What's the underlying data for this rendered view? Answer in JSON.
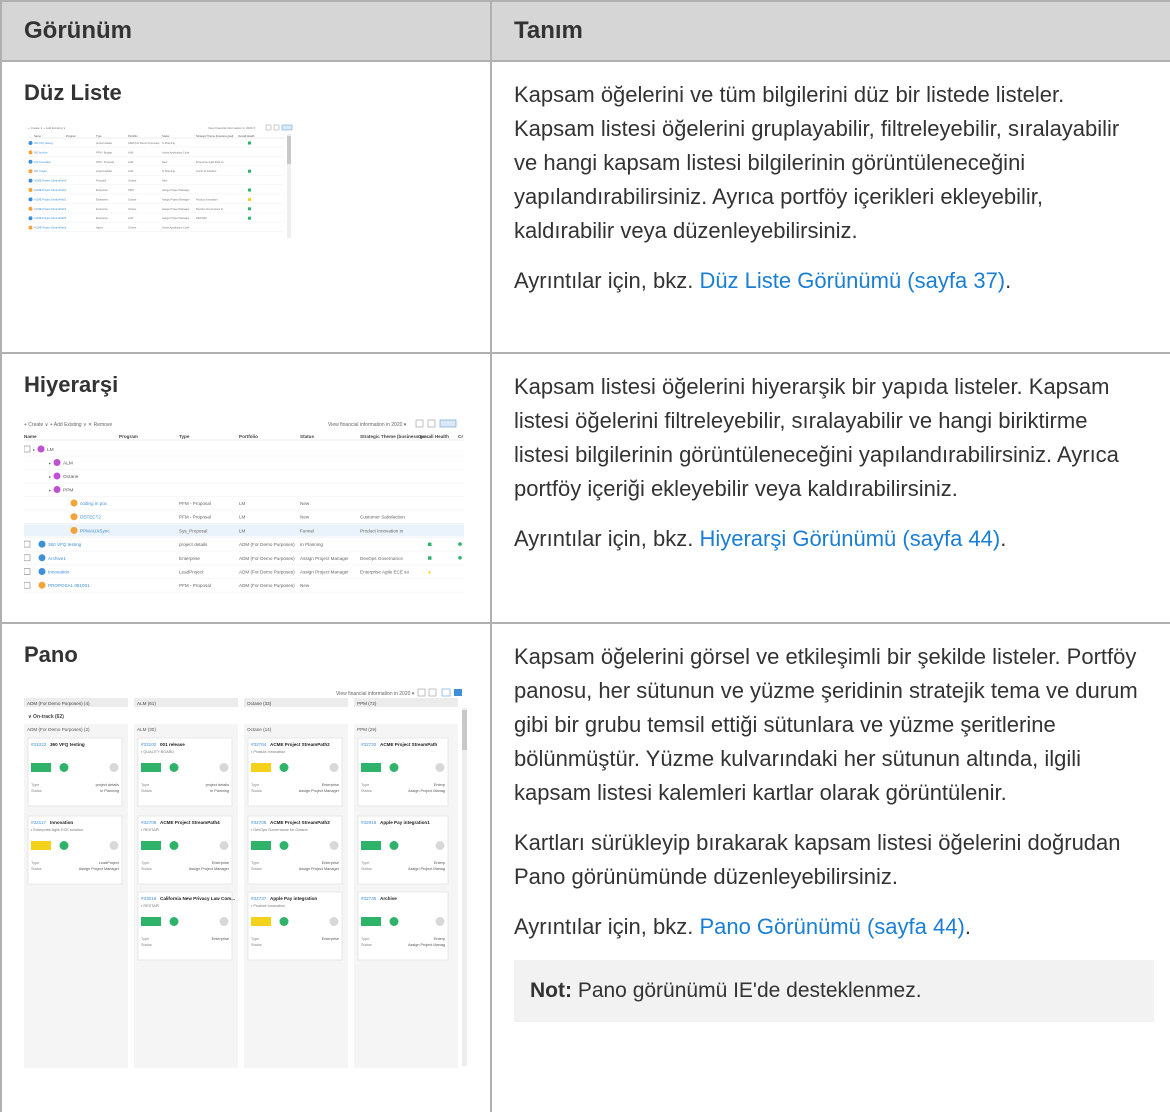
{
  "table": {
    "headers": [
      "Görünüm",
      "Tanım"
    ],
    "rows": [
      {
        "name": "Düz Liste",
        "description": "Kapsam öğelerini ve tüm bilgilerini düz bir listede listeler. Kapsam listesi öğelerini gruplayabilir, filtreleyebilir, sıralayabilir ve hangi kapsam listesi bilgilerinin görüntüleneceğini yapılandırabilirsiniz. Ayrıca portföy içerikleri ekleyebilir, kaldırabilir veya düzenleyebilirsiniz.",
        "details_prefix": "Ayrıntılar için, bkz. ",
        "details_link": "Düz Liste Görünümü (sayfa 37)",
        "details_suffix": "."
      },
      {
        "name": "Hiyerarşi",
        "description": "Kapsam listesi öğelerini hiyerarşik bir yapıda listeler. Kapsam listesi öğelerini filtreleyebilir, sıralayabilir ve hangi biriktirme listesi bilgilerinin görüntüleneceğini yapılandırabilirsiniz. Ayrıca portföy içeriği ekleyebilir veya kaldırabilirsiniz.",
        "details_prefix": "Ayrıntılar için, bkz. ",
        "details_link": "Hiyerarşi Görünümü (sayfa 44)",
        "details_suffix": "."
      },
      {
        "name": "Pano",
        "description": "Kapsam öğelerini görsel ve etkileşimli bir şekilde listeler. Portföy panosu, her sütunun ve yüzme şeridinin stratejik tema ve durum gibi bir grubu temsil ettiği sütunlara ve yüzme şeritlerine bölünmüştür. Yüzme kulvarındaki her sütunun altında, ilgili kapsam listesi kalemleri kartlar olarak görüntülenir.",
        "description2": "Kartları sürükleyip bırakarak kapsam listesi öğelerini doğrudan Pano görünümünde düzenleyebilirsiniz.",
        "details_prefix": "Ayrıntılar için, bkz. ",
        "details_link": "Pano Görünümü (sayfa 44)",
        "details_suffix": ".",
        "note_label": "Not:",
        "note_text": " Pano görünümü IE'de desteklenmez."
      }
    ]
  },
  "flat_thumb": {
    "toolbar_left": "+ Create ∨  + Add Existing ∨",
    "toolbar_right": "View financial information in 2020 ▾",
    "header": [
      "Name ↑",
      "Program",
      "Type",
      "Portfolio",
      "Status",
      "Strategic Theme (business goal)",
      "Overall Health"
    ],
    "rows": [
      [
        "360 VFQ testing",
        "",
        "project details",
        "ADM (For Demo Purposes)",
        "In Planning",
        "",
        "green"
      ],
      [
        "001 Archive",
        "",
        "PFM - Budget",
        "ALM",
        "Active Application Code",
        "",
        ""
      ],
      [
        "210 Innovation",
        "",
        "PFM - Proposal",
        "ALM",
        "New",
        "Enterprise Agile ECE so",
        ""
      ],
      [
        "001 Create",
        "",
        "project details",
        "ALM",
        "In Planning",
        "Limits To Initiative",
        "green"
      ],
      [
        "ACME Project StreamPath4",
        "",
        "Proposal",
        "Octane",
        "New",
        "",
        ""
      ],
      [
        "ACME Project StreamPath2",
        "",
        "Enterprise",
        "PPM",
        "Assign Project Manager",
        "",
        "green"
      ],
      [
        "ACME Project StreamPath3",
        "",
        "Enterprise",
        "Octane",
        "Assign Project Manager",
        "Product Innovation",
        "yellow"
      ],
      [
        "ACME Project StreamPath4",
        "",
        "Enterprise",
        "Octane",
        "Assign Project Manager",
        "DevOps Governance fo",
        "green"
      ],
      [
        "ACME Project StreamPath5",
        "",
        "Enterprise",
        "ALM",
        "Assign Project Manager",
        "RESTAPI",
        "green"
      ],
      [
        "ACME Project StreamPath6",
        "",
        "Agent",
        "Octane",
        "Active Application Code",
        "",
        ""
      ]
    ]
  },
  "hier_thumb": {
    "toolbar_left": "+ Create ∨   + Add Existing ∨   ✕  Remove",
    "toolbar_right": "View financial information in   2020   ▾",
    "header": [
      "Name",
      "Program",
      "Type",
      "Portfolio",
      "Status",
      "Strategic Theme (business go...",
      "Overall Health",
      "Cr"
    ],
    "groups": [
      "LM",
      "ALM",
      "Octane",
      "PPM"
    ],
    "rows": [
      [
        "coding in poc",
        "",
        "PFM - Proposal",
        "LM",
        "New",
        "",
        ""
      ],
      [
        "DEFECT2",
        "",
        "PFM - Proposal",
        "LM",
        "New",
        "Customer Satisfaction",
        ""
      ],
      [
        "PPMAUXSync",
        "",
        "Sys_Proposal",
        "LM",
        "Funnel",
        "Product Innovation in",
        ""
      ],
      [
        "360 VFQ testing",
        "",
        "project details",
        "ADM (For Demo Purposes)",
        "In Planning",
        "",
        "green"
      ],
      [
        "Archive1",
        "",
        "Enterprise",
        "ADM (For Demo Purposes)",
        "Assign Project Manager",
        "DevOps Governance",
        "green"
      ],
      [
        "Innovation",
        "",
        "LeadProject",
        "ADM (For Demo Purposes)",
        "Assign Project Manager",
        "Enterprise Agile ECE so",
        "yellow"
      ],
      [
        "PROPOSAL 091001",
        "",
        "PFM - Proposal",
        "ADM (For Demo Purposes)",
        "New",
        "",
        ""
      ]
    ]
  },
  "board_thumb": {
    "toolbar_right": "View financial information in   2020   ▾",
    "columns": [
      "ADM (For Demo Purposes) (4)",
      "ALM (61)",
      "Octane (33)",
      "PPM (72)"
    ],
    "lane": "∨ On-track (62)",
    "sub_columns": [
      "ADM (For Demo Purposes) (2)",
      "ALM (30)",
      "Octane (14)",
      "PPM (29)"
    ],
    "cards": [
      {
        "col": 0,
        "row": 0,
        "id": "#31022",
        "title": "360 VFQ testing",
        "tag": "",
        "type": "project details",
        "status": "In Planning",
        "bar": "green"
      },
      {
        "col": 0,
        "row": 1,
        "id": "#32117",
        "title": "Innovation",
        "tag": "Enterprise Agile ECE solution",
        "type": "LeadProject",
        "status": "Assign Project Manager",
        "bar": "yellow"
      },
      {
        "col": 1,
        "row": 0,
        "id": "#33102",
        "title": "001 release",
        "tag": "QUALITY BOARD",
        "type": "project details",
        "status": "In Planning",
        "bar": "green"
      },
      {
        "col": 1,
        "row": 1,
        "id": "#32708",
        "title": "ACME Project StreamPath4",
        "tag": "RESTAPI",
        "type": "Enterprise",
        "status": "Assign Project Manager",
        "bar": "green"
      },
      {
        "col": 1,
        "row": 2,
        "id": "#33019",
        "title": "California New Privacy Law Com...",
        "tag": "RESTAPI",
        "type": "Enterprise",
        "status": "",
        "bar": "green"
      },
      {
        "col": 2,
        "row": 0,
        "id": "#32704",
        "title": "ACME Project StreamPath2",
        "tag": "Product Innovation",
        "type": "Enterprise",
        "status": "Assign Project Manager",
        "bar": "yellow"
      },
      {
        "col": 2,
        "row": 1,
        "id": "#32705",
        "title": "ACME Project StreamPath3",
        "tag": "DevOps Governance for Octane",
        "type": "Enterprise",
        "status": "Assign Project Manager",
        "bar": "green"
      },
      {
        "col": 2,
        "row": 2,
        "id": "#32737",
        "title": "Apple Pay integration",
        "tag": "Product Innovation",
        "type": "Enterprise",
        "status": "",
        "bar": "yellow"
      },
      {
        "col": 3,
        "row": 0,
        "id": "#32732",
        "title": "ACME Project StreamPath",
        "tag": "",
        "type": "Enterp",
        "status": "Assign Project Manag",
        "bar": "green"
      },
      {
        "col": 3,
        "row": 1,
        "id": "#32916",
        "title": "Apple Pay integration1",
        "tag": "",
        "type": "Enterp",
        "status": "Assign Project Manag",
        "bar": "green"
      },
      {
        "col": 3,
        "row": 2,
        "id": "#32735",
        "title": "Archive",
        "tag": "",
        "type": "Enterp",
        "status": "Assign Project Manag",
        "bar": "green"
      }
    ],
    "type_label": "Type",
    "status_label": "Status"
  },
  "colors": {
    "header_bg": "#d6d6d6",
    "border": "#b0b0b0",
    "link": "#1a7fd4",
    "note_bg": "#f2f2f2",
    "green": "#2fb36a",
    "yellow": "#f4d11a"
  }
}
